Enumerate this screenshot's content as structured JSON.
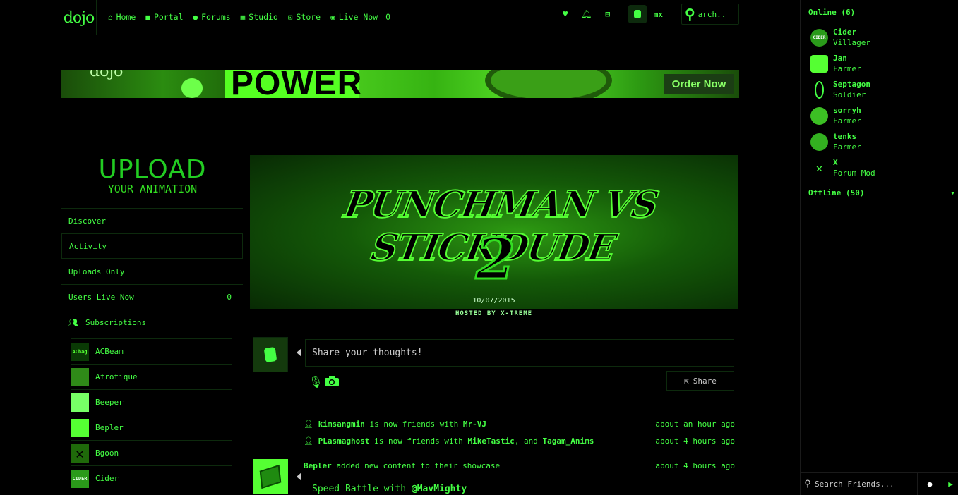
{
  "logo": "dojo",
  "nav": {
    "items": [
      {
        "label": "Home",
        "icon": "home-icon",
        "glyph": "⌂"
      },
      {
        "label": "Portal",
        "icon": "video-icon",
        "glyph": "■"
      },
      {
        "label": "Forums",
        "icon": "comments-icon",
        "glyph": "●"
      },
      {
        "label": "Studio",
        "icon": "film-icon",
        "glyph": "▦"
      },
      {
        "label": "Store",
        "icon": "cart-icon",
        "glyph": "⊡"
      },
      {
        "label": "Live Now",
        "icon": "eye-icon",
        "glyph": "◉"
      }
    ],
    "live_count": "0",
    "username": "mx",
    "search_text": "arch.."
  },
  "banner": {
    "headline": "POWER",
    "cta": "Order Now",
    "brand": "dojo"
  },
  "upload": {
    "line1": "UPLOAD",
    "line2": "YOUR ANIMATION"
  },
  "left_menu": {
    "discover": "Discover",
    "activity": "Activity",
    "uploads_only": "Uploads Only",
    "users_live_now": "Users Live Now",
    "users_live_count": "0",
    "subscriptions": "Subscriptions"
  },
  "subscriptions": [
    {
      "name": "ACBeam",
      "thumb": "ACbag"
    },
    {
      "name": "Afrotique",
      "thumb": ""
    },
    {
      "name": "Beeper",
      "thumb": ""
    },
    {
      "name": "Bepler",
      "thumb": ""
    },
    {
      "name": "Bgoon",
      "thumb": ""
    },
    {
      "name": "Cider",
      "thumb": "CIDER"
    }
  ],
  "hero": {
    "title": "PUNCHMAN VS STICKDUDE",
    "vs": "VS",
    "number": "2",
    "date": "10/07/2015",
    "hosted": "HOSTED BY X-TREME"
  },
  "composer": {
    "placeholder": "Share your thoughts!",
    "share_label": "Share"
  },
  "feed": [
    {
      "user": "kimsangmin",
      "text": " is now friends with ",
      "other": "Mr-VJ",
      "extra": "",
      "other2": "",
      "time": "about an hour ago"
    },
    {
      "user": "PLasmaghost",
      "text": " is now friends with ",
      "other": "MikeTastic",
      "extra": ", and ",
      "other2": "Tagam_Anims",
      "time": "about 4 hours ago"
    }
  ],
  "feed_post": {
    "user": "Bepler",
    "text": " added new content to their showcase",
    "time": "about 4 hours ago",
    "title_prefix": "Speed Battle with ",
    "title_mention": "@MavMighty"
  },
  "friends_panel": {
    "online_header": "Online (6)",
    "offline_header": "Offline (50)",
    "search_placeholder": "Search Friends...",
    "online": [
      {
        "name": "Cider",
        "role": "Villager",
        "avatar_text": "CIDER"
      },
      {
        "name": "Jan",
        "role": "Farmer",
        "avatar_text": ""
      },
      {
        "name": "Septagon",
        "role": "Soldier",
        "avatar_text": ""
      },
      {
        "name": "sorryh",
        "role": "Farmer",
        "avatar_text": ""
      },
      {
        "name": "tenks",
        "role": "Farmer",
        "avatar_text": ""
      },
      {
        "name": "X",
        "role": "Forum Mod",
        "avatar_text": "✕"
      }
    ]
  },
  "colors": {
    "accent": "#44ff44",
    "background": "#000000",
    "divider": "#0d2a0d"
  }
}
